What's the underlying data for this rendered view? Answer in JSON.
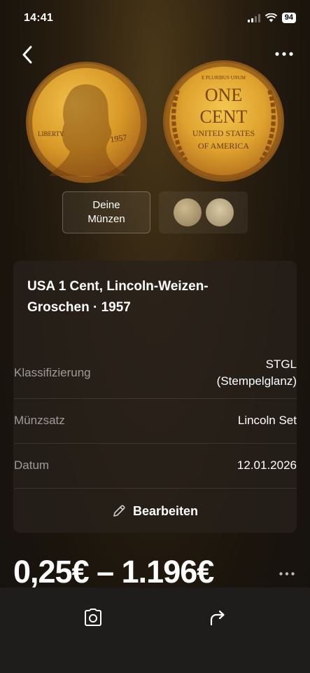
{
  "status_bar": {
    "time": "14:41",
    "battery": "94"
  },
  "nav": {
    "back_icon": "chevron-left-icon",
    "more_icon": "ellipsis-icon"
  },
  "coin_images": {
    "front_text": {
      "liberty": "LIBERTY",
      "year": "1957"
    },
    "back_text": {
      "one": "ONE",
      "cent": "CENT",
      "line1": "UNITED STATES",
      "line2": "OF AMERICA",
      "motto": "E PLURIBUS UNUM"
    }
  },
  "thumbs": {
    "my_coins_line1": "Deine",
    "my_coins_line2": "Münzen"
  },
  "coin": {
    "title": "USA 1 Cent, Lincoln-Weizen-Groschen · 1957",
    "rows": [
      {
        "label": "Klassifizierung",
        "value_line1": "STGL",
        "value_line2": "(Stempelglanz)"
      },
      {
        "label": "Münzsatz",
        "value": "Lincoln Set"
      },
      {
        "label": "Datum",
        "value": "12.01.2026"
      }
    ],
    "edit_label": "Bearbeiten"
  },
  "price": {
    "range": "0,25€ – 1.196€"
  },
  "bottom_bar": {
    "scan_icon": "camera-scan-icon",
    "share_icon": "share-icon"
  }
}
